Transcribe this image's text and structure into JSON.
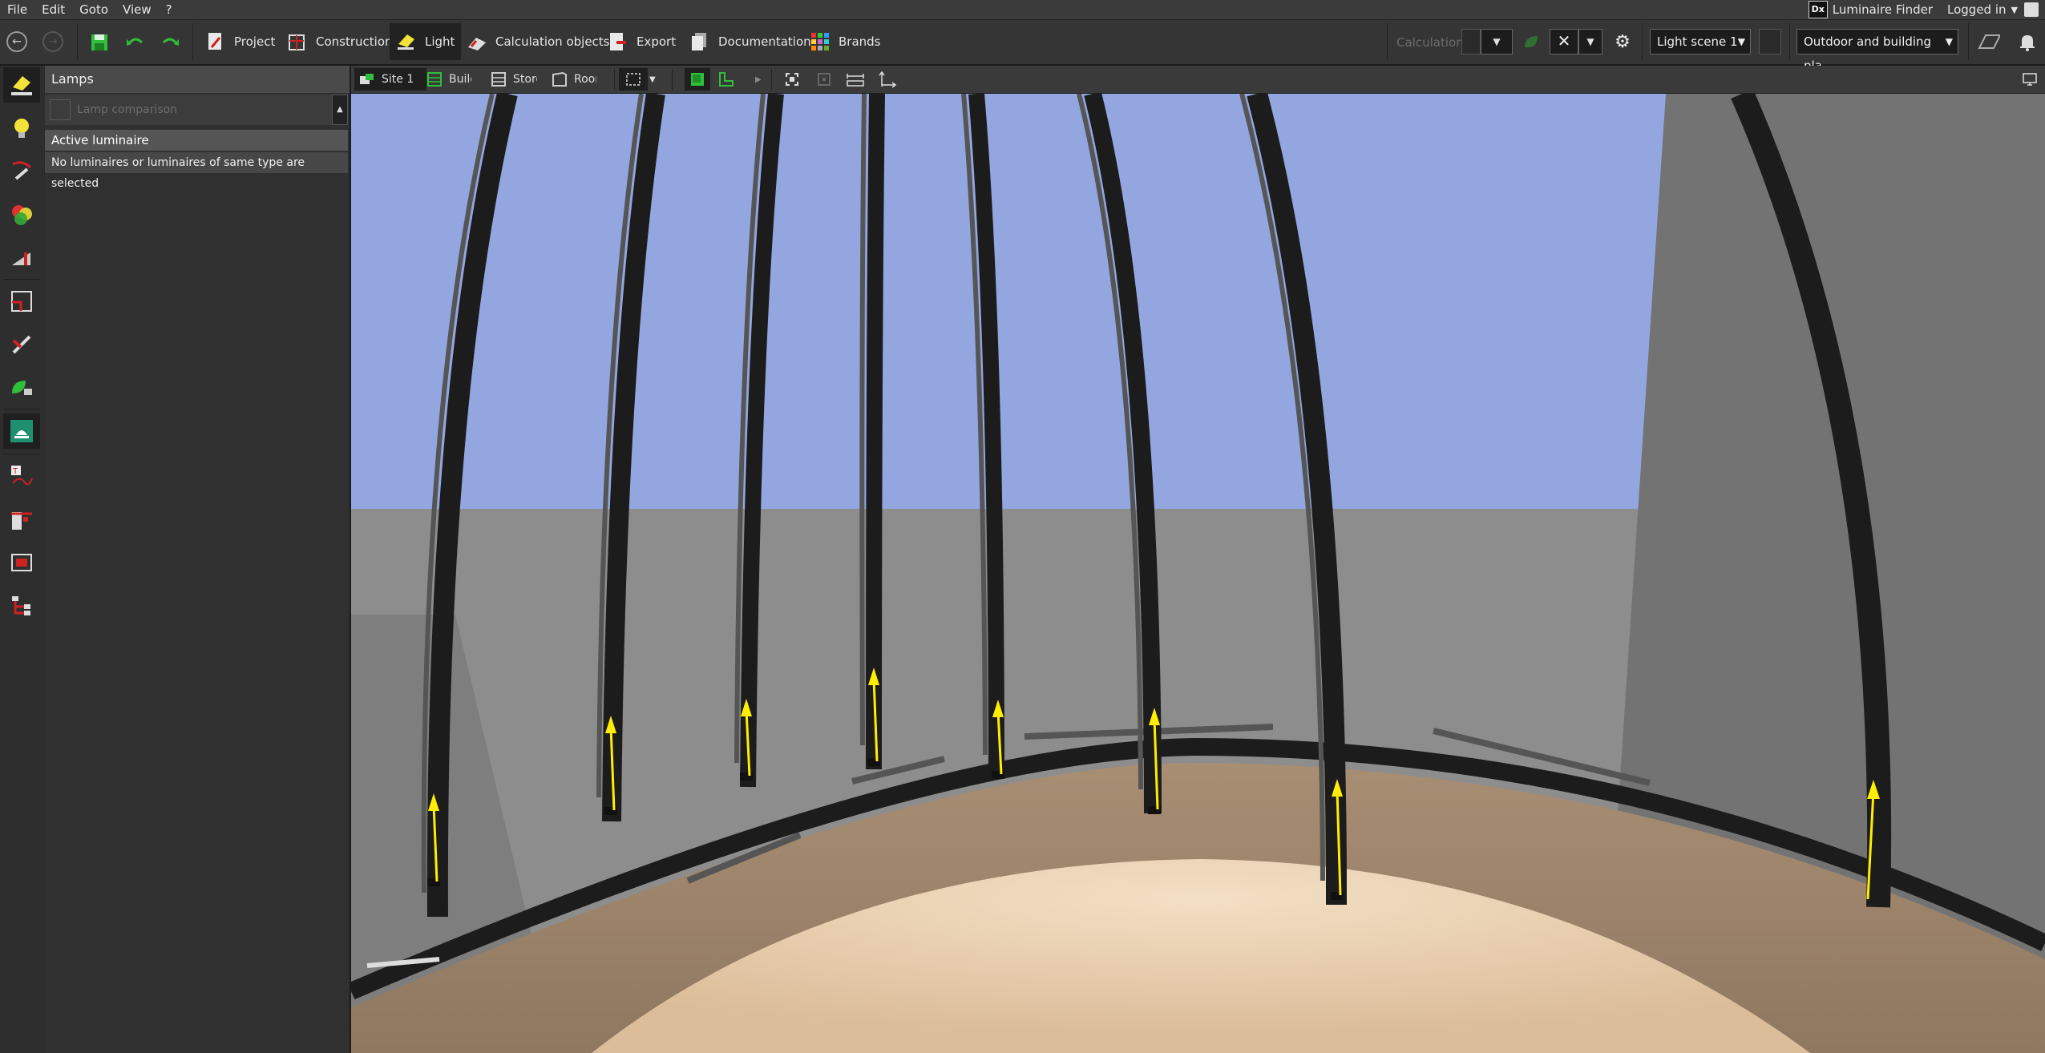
{
  "menu": {
    "items": [
      "File",
      "Edit",
      "Goto",
      "View",
      "?"
    ]
  },
  "topright": {
    "luminaire_finder": "Luminaire Finder",
    "logo_text": "Dx",
    "login": "Logged in"
  },
  "toolbar": {
    "tabs": [
      "Project",
      "Construction",
      "Light",
      "Calculation objects",
      "Export",
      "Documentation",
      "Brands"
    ],
    "active_tab": "Light",
    "calculation_label": "Calculation",
    "light_scene": "Light scene 1",
    "view_mode": "Outdoor and building pla..."
  },
  "panel": {
    "title": "Lamps",
    "lamp_comparison": "Lamp comparison",
    "active_luminaire_header": "Active luminaire",
    "active_luminaire_message": "No luminaires or luminaires of same type are selected"
  },
  "viewbar": {
    "site": "Site 1",
    "building": "Building",
    "storey": "Storey",
    "room": "Room"
  },
  "colors": {
    "accent_green": "#2fbf3a",
    "sky": "#93a6e0",
    "wall": "#8d8d8d",
    "floor": "#e6cbab",
    "beam": "#1c1c1c",
    "arrow": "#ffee00"
  },
  "icons": {
    "left_strip": [
      "lamp-icon",
      "bulb-icon",
      "aim-tool-icon",
      "color-balls-icon",
      "light-distribution-icon",
      "room-shape-icon",
      "tools-icon",
      "leaf-plug-icon",
      "emergency-light-icon",
      "text-curve-icon",
      "cutplane-icon",
      "frame-icon",
      "tree-icon"
    ]
  }
}
